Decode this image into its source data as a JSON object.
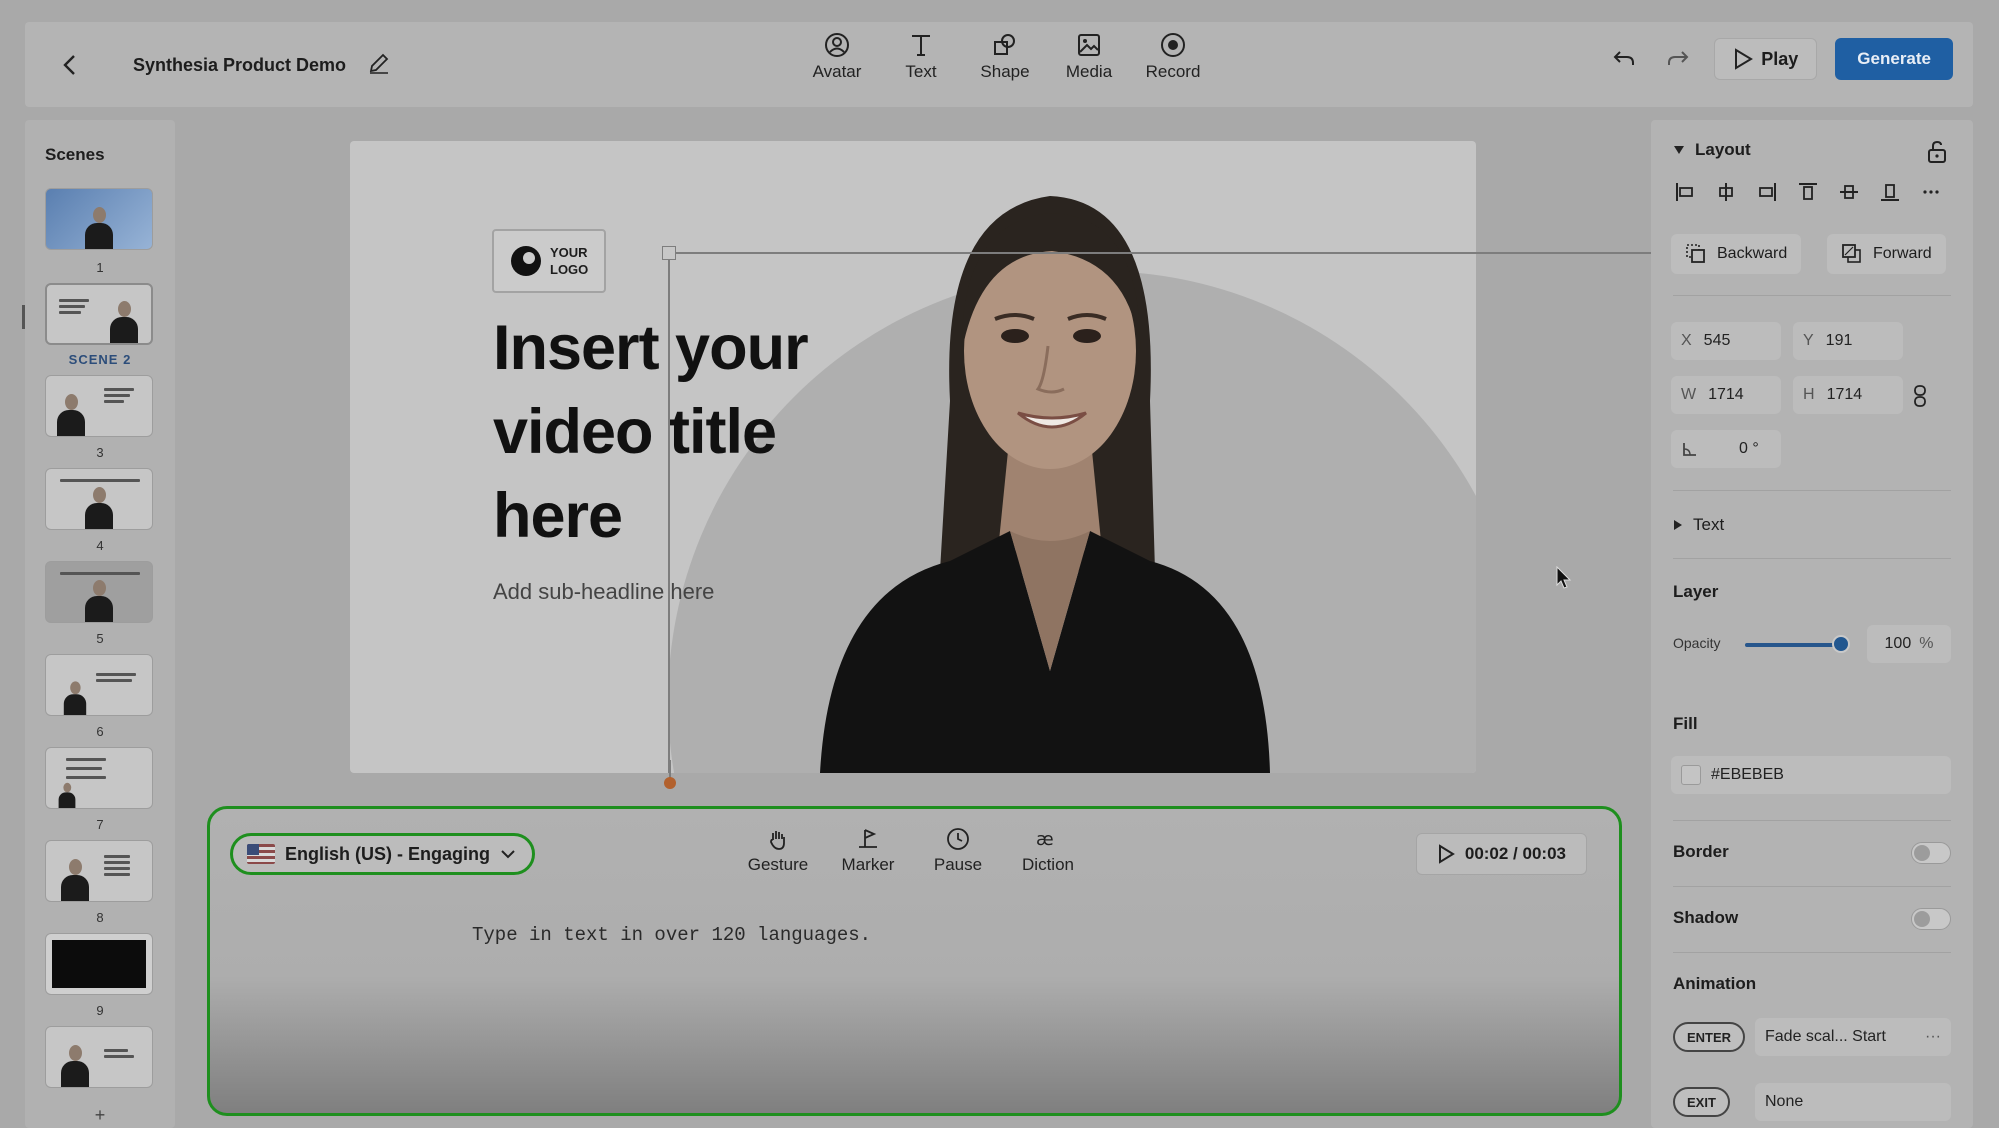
{
  "header": {
    "title": "Synthesia Product Demo",
    "tools": [
      {
        "label": "Avatar",
        "icon": "avatar-icon"
      },
      {
        "label": "Text",
        "icon": "text-icon"
      },
      {
        "label": "Shape",
        "icon": "shape-icon"
      },
      {
        "label": "Media",
        "icon": "media-icon"
      },
      {
        "label": "Record",
        "icon": "record-icon"
      }
    ],
    "play_label": "Play",
    "generate_label": "Generate"
  },
  "scenes": {
    "title": "Scenes",
    "items": [
      {
        "num": "1"
      },
      {
        "num": "SCENE 2",
        "selected": true
      },
      {
        "num": "3"
      },
      {
        "num": "4"
      },
      {
        "num": "5"
      },
      {
        "num": "6"
      },
      {
        "num": "7"
      },
      {
        "num": "8"
      },
      {
        "num": "9"
      },
      {
        "num": ""
      }
    ],
    "add_label": "+"
  },
  "canvas": {
    "logo_line1": "YOUR",
    "logo_line2": "LOGO",
    "title_line1": "Insert your",
    "title_line2": "video title",
    "title_line3": "here",
    "subheadline": "Add sub-headline here"
  },
  "script": {
    "language": "English (US) - Engaging",
    "tools": [
      {
        "label": "Gesture",
        "icon": "gesture-icon"
      },
      {
        "label": "Marker",
        "icon": "marker-icon"
      },
      {
        "label": "Pause",
        "icon": "clock-icon"
      },
      {
        "label": "Diction",
        "icon": "diction-icon"
      }
    ],
    "timer": "00:02 / 00:03",
    "text": "Type in text in over 120 languages."
  },
  "properties": {
    "layout_title": "Layout",
    "backward_label": "Backward",
    "forward_label": "Forward",
    "x_key": "X",
    "x_value": "545",
    "y_key": "Y",
    "y_value": "191",
    "w_key": "W",
    "w_value": "1714",
    "h_key": "H",
    "h_value": "1714",
    "rotation_value": "0 °",
    "text_title": "Text",
    "layer_title": "Layer",
    "opacity_label": "Opacity",
    "opacity_value": "100",
    "opacity_unit": "%",
    "opacity_level": 1.0,
    "fill_title": "Fill",
    "fill_value": "#EBEBEB",
    "border_title": "Border",
    "shadow_title": "Shadow",
    "animation_title": "Animation",
    "enter_badge": "ENTER",
    "enter_value": "Fade scal... Start",
    "enter_more": "···",
    "exit_badge": "EXIT",
    "exit_value": "None"
  },
  "colors": {
    "accent": "#1f5fa3",
    "highlight": "#1e8f1e"
  }
}
